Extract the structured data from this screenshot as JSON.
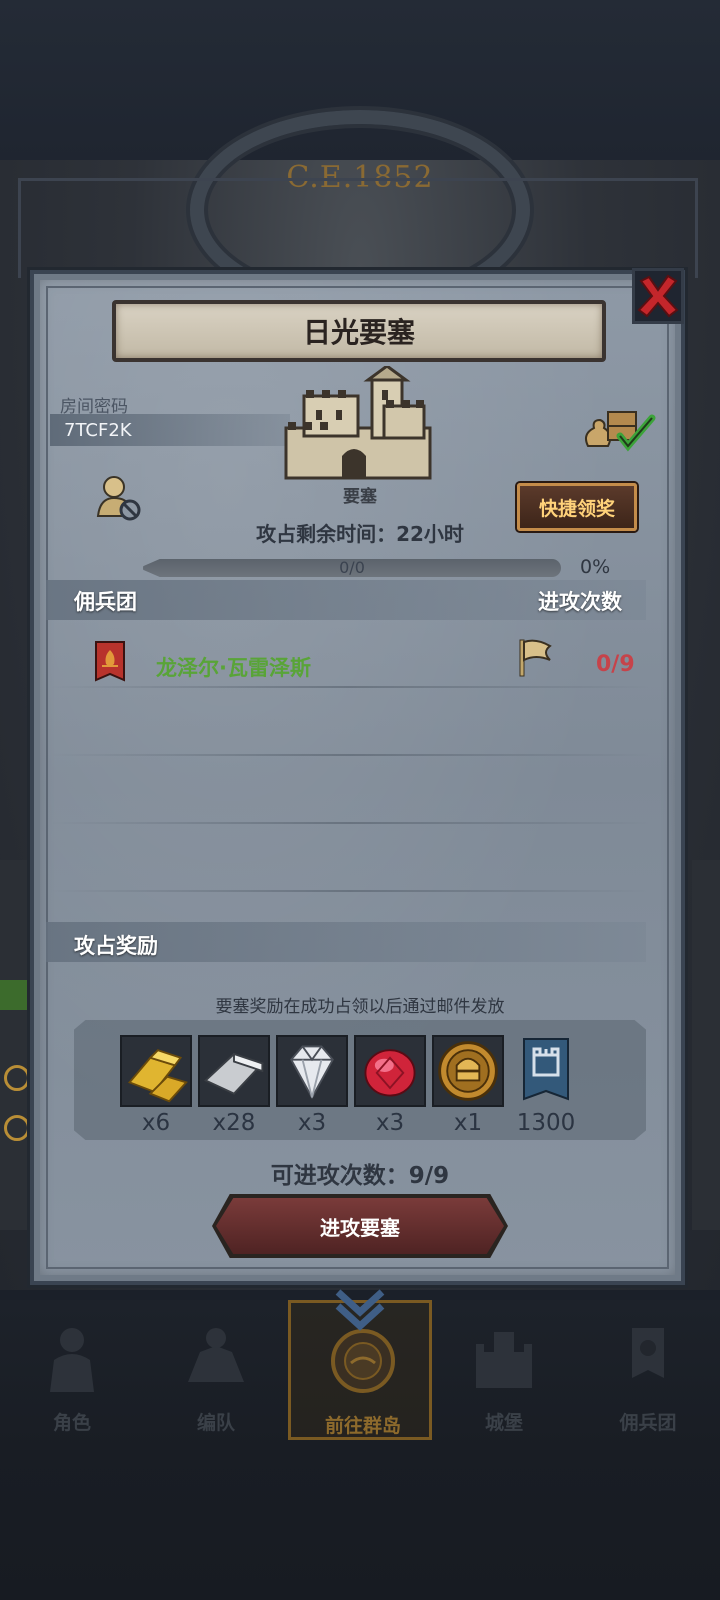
{
  "background": {
    "year": "C.E.1852"
  },
  "dialog": {
    "title": "日光要塞",
    "room": {
      "label": "房间密码",
      "code": "7TCF2K"
    },
    "building_label": "要塞",
    "quick_claim_label": "快捷领奖",
    "time_left": "攻占剩余时间：22小时",
    "progress": {
      "text": "0/0",
      "percent_label": "0%",
      "fraction": 0.0
    },
    "guild_section": {
      "title": "佣兵团",
      "attacks_header": "进攻次数",
      "rows": [
        {
          "name": "龙泽尔·瓦雷泽斯",
          "attacks": "0/9"
        }
      ]
    },
    "rewards_section": {
      "title": "攻占奖励",
      "note": "要塞奖励在成功占领以后通过邮件发放",
      "items": [
        {
          "icon": "gold-bar-icon",
          "qty": "x6"
        },
        {
          "icon": "iron-bar-icon",
          "qty": "x28"
        },
        {
          "icon": "diamond-icon",
          "qty": "x3"
        },
        {
          "icon": "ruby-icon",
          "qty": "x3"
        },
        {
          "icon": "knight-medal-icon",
          "qty": "x1"
        },
        {
          "icon": "fortress-banner-icon",
          "qty": "1300"
        }
      ]
    },
    "attempts_text": "可进攻次数：9/9",
    "attack_button": "进攻要塞"
  },
  "bottom_nav": {
    "items": [
      {
        "label": "角色",
        "icon": "knight-icon"
      },
      {
        "label": "编队",
        "icon": "formation-icon"
      },
      {
        "label": "前往群岛",
        "icon": "islands-icon",
        "active": true
      },
      {
        "label": "城堡",
        "icon": "castle-icon"
      },
      {
        "label": "佣兵团",
        "icon": "mercenary-icon"
      }
    ]
  },
  "colors": {
    "guild_name": "#59a438",
    "attack_count": "#c6434a",
    "quick_claim_text": "#ffd27a",
    "active_nav": "#8d6a2c"
  }
}
